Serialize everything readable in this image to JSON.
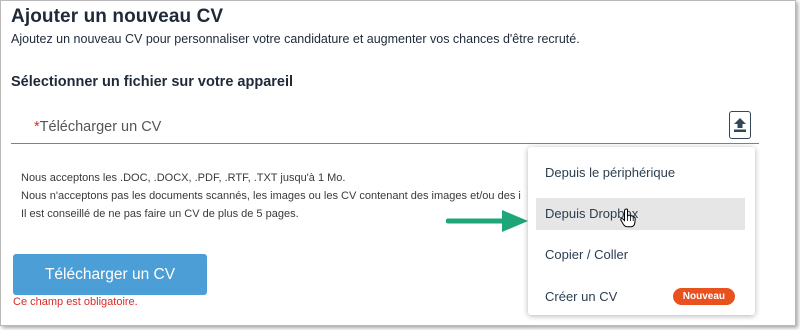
{
  "header": {
    "title": "Ajouter un nouveau CV",
    "subtitle": "Ajoutez un nouveau CV pour personnaliser votre candidature et augmenter vos chances d'être recruté."
  },
  "section": {
    "title": "Sélectionner un fichier sur votre appareil"
  },
  "upload": {
    "required_mark": "*",
    "label": "Télécharger un CV",
    "icon": "upload-icon"
  },
  "info": {
    "lines": [
      "Nous acceptons les .DOC, .DOCX, .PDF, .RTF, .TXT jusqu'à 1 Mo.",
      "Nous n'acceptons pas les documents scannés, les images ou les CV contenant des images et/ou des ic",
      "Il est conseillé de ne pas faire un CV de plus de 5 pages."
    ]
  },
  "actions": {
    "upload_button": "Télécharger un CV",
    "error": "Ce champ est obligatoire."
  },
  "menu": {
    "items": [
      {
        "label": "Depuis le périphérique"
      },
      {
        "label": "Depuis Dropbox"
      },
      {
        "label": "Copier / Coller"
      },
      {
        "label": "Créer un CV",
        "badge": "Nouveau"
      }
    ]
  },
  "colors": {
    "accent": "#4b9fd6",
    "error": "#d62c2c",
    "badge": "#e8521f",
    "annotation_arrow": "#1ea67a"
  }
}
